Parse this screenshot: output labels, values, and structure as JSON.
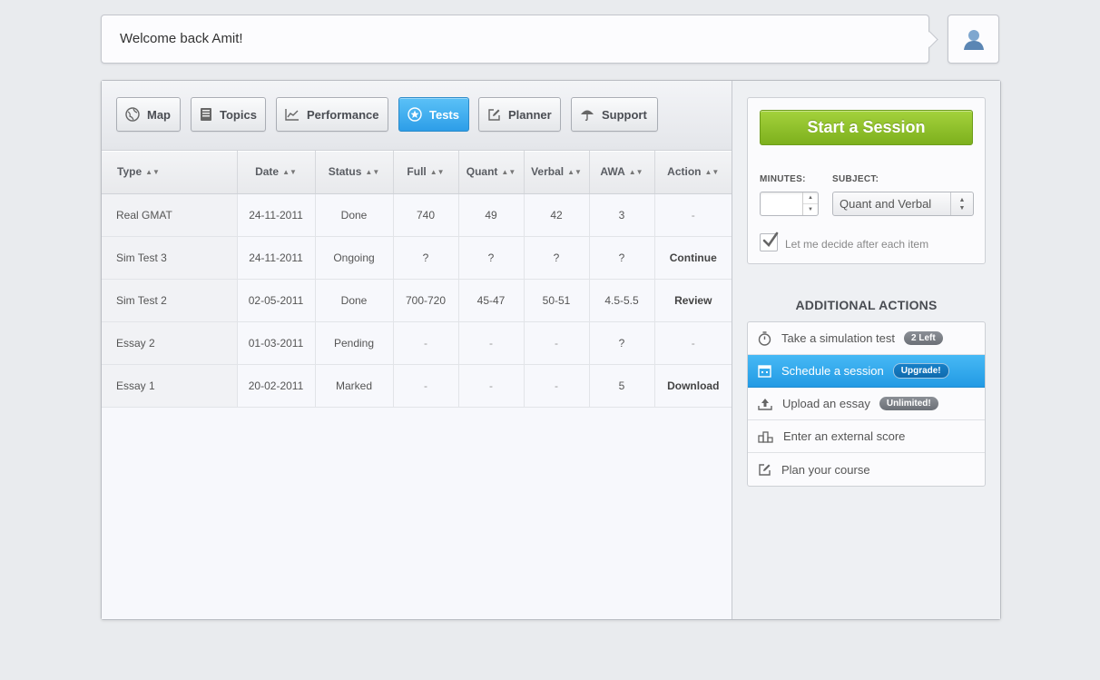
{
  "header": {
    "welcome": "Welcome back Amit!"
  },
  "nav": {
    "items": [
      {
        "label": "Map",
        "icon": "globe-icon"
      },
      {
        "label": "Topics",
        "icon": "book-icon"
      },
      {
        "label": "Performance",
        "icon": "chart-icon"
      },
      {
        "label": "Tests",
        "icon": "star-icon",
        "active": true
      },
      {
        "label": "Planner",
        "icon": "edit-icon"
      },
      {
        "label": "Support",
        "icon": "umbrella-icon"
      }
    ]
  },
  "table": {
    "columns": [
      "Type",
      "Date",
      "Status",
      "Full",
      "Quant",
      "Verbal",
      "AWA",
      "Action"
    ],
    "rows": [
      {
        "type": "Real GMAT",
        "date": "24-11-2011",
        "status": "Done",
        "full": "740",
        "quant": "49",
        "verbal": "42",
        "awa": "3",
        "action": "-"
      },
      {
        "type": "Sim Test 3",
        "date": "24-11-2011",
        "status": "Ongoing",
        "full": "?",
        "quant": "?",
        "verbal": "?",
        "awa": "?",
        "action": "Continue"
      },
      {
        "type": "Sim Test 2",
        "date": "02-05-2011",
        "status": "Done",
        "full": "700-720",
        "quant": "45-47",
        "verbal": "50-51",
        "awa": "4.5-5.5",
        "action": "Review"
      },
      {
        "type": "Essay 2",
        "date": "01-03-2011",
        "status": "Pending",
        "full": "-",
        "quant": "-",
        "verbal": "-",
        "awa": "?",
        "action": "-"
      },
      {
        "type": "Essay 1",
        "date": "20-02-2011",
        "status": "Marked",
        "full": "-",
        "quant": "-",
        "verbal": "-",
        "awa": "5",
        "action": "Download"
      }
    ]
  },
  "session": {
    "start_label": "Start a Session",
    "minutes_label": "MINUTES:",
    "minutes_value": "",
    "subject_label": "SUBJECT:",
    "subject_value": "Quant and Verbal",
    "decide_label": "Let me decide after each item",
    "decide_checked": true
  },
  "additional": {
    "title": "ADDITIONAL ACTIONS",
    "items": [
      {
        "label": "Take a simulation test",
        "badge": "2 Left",
        "icon": "stopwatch-icon"
      },
      {
        "label": "Schedule a session",
        "badge": "Upgrade!",
        "icon": "calendar-icon",
        "active": true
      },
      {
        "label": "Upload an essay",
        "badge": "Unlimited!",
        "icon": "upload-icon"
      },
      {
        "label": "Enter an external score",
        "badge": "",
        "icon": "podium-icon"
      },
      {
        "label": "Plan your course",
        "badge": "",
        "icon": "edit-icon"
      }
    ]
  },
  "colors": {
    "accent_blue": "#2d9ee8",
    "start_green": "#8cc02a",
    "badge_gray": "#7a7e85"
  }
}
